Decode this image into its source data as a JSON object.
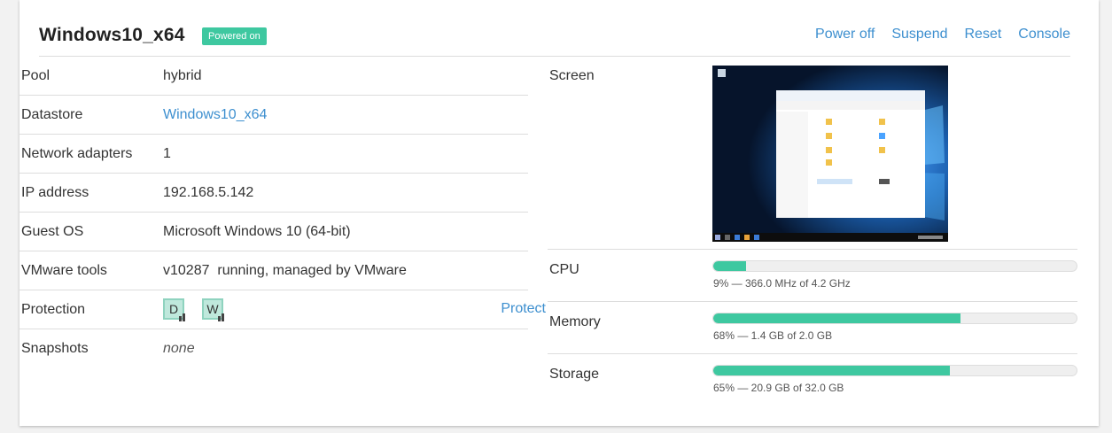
{
  "vm": {
    "name": "Windows10_x64",
    "status": "Powered on",
    "status_color": "#3ec8a0"
  },
  "actions": {
    "power_off": "Power off",
    "suspend": "Suspend",
    "reset": "Reset",
    "console": "Console"
  },
  "details": [
    {
      "label": "Pool",
      "value": "hybrid"
    },
    {
      "label": "Datastore",
      "value": "Windows10_x64"
    },
    {
      "label": "Network adapters",
      "value": "1"
    },
    {
      "label": "IP address",
      "value": "192.168.5.142"
    },
    {
      "label": "Guest OS",
      "value": "Microsoft Windows 10 (64-bit)"
    },
    {
      "label": "VMware tools",
      "value": "v10287  running, managed by VMware"
    },
    {
      "label": "Protection",
      "value": ""
    },
    {
      "label": "Snapshots",
      "value": "none"
    }
  ],
  "protection": {
    "badges": [
      {
        "letter": "D"
      },
      {
        "letter": "W"
      }
    ],
    "protect_label": "Protect"
  },
  "screen": {
    "label": "Screen"
  },
  "usage": {
    "cpu": {
      "label": "CPU",
      "percent": 9,
      "text": "9% — 366.0 MHz of 4.2 GHz"
    },
    "memory": {
      "label": "Memory",
      "percent": 68,
      "text": "68% — 1.4 GB of 2.0 GB"
    },
    "storage": {
      "label": "Storage",
      "percent": 65,
      "text": "65% — 20.9 GB of 32.0 GB"
    }
  },
  "colors": {
    "accent": "#3ec8a0",
    "link": "#3d8fcf"
  }
}
